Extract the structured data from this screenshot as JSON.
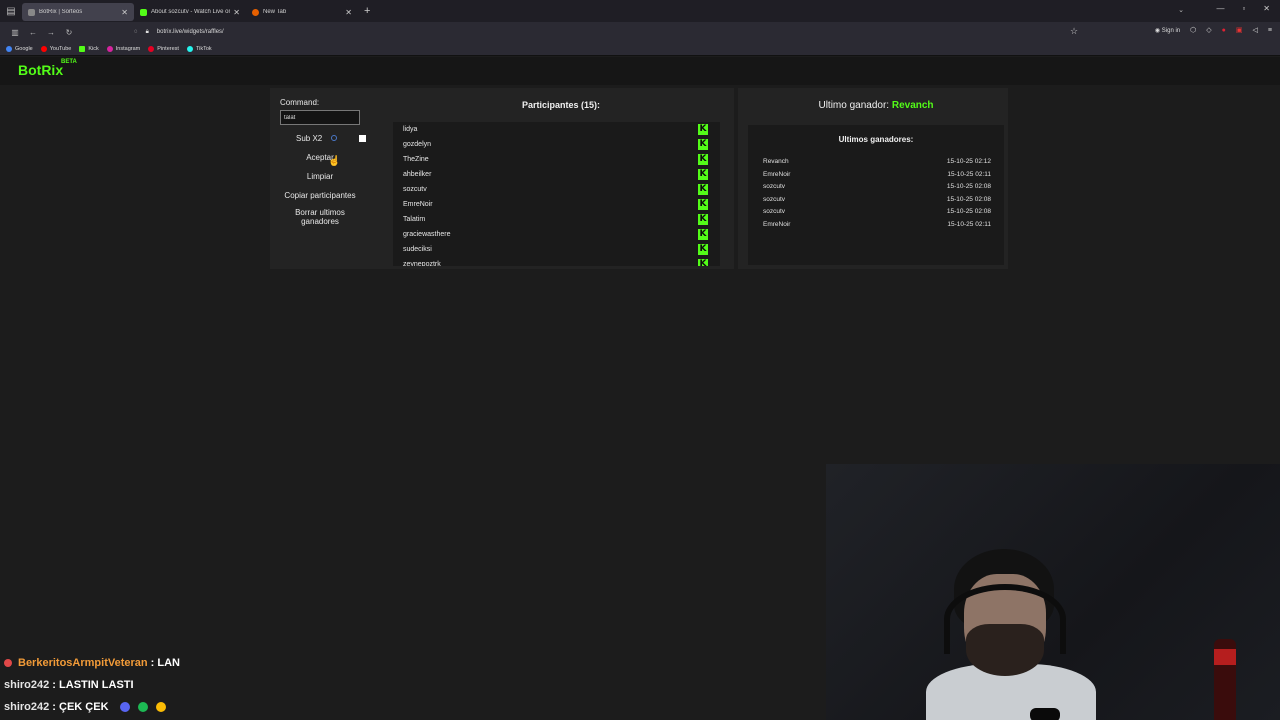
{
  "browser": {
    "tabs": [
      {
        "label": "BotRix | Sorteos",
        "active": true
      },
      {
        "label": "About sozcutv - Watch Live on",
        "active": false
      },
      {
        "label": "New Tab",
        "active": false
      }
    ],
    "url": "botrix.live/widgets/raffles/",
    "signin_label": "Sign in",
    "bookmarks": [
      "Google",
      "YouTube",
      "Kick",
      "Instagram",
      "Pinterest",
      "TikTok"
    ]
  },
  "app": {
    "logo": "BotRix",
    "beta": "BETA"
  },
  "controls": {
    "command_label": "Command:",
    "command_value": "talat",
    "sub_label": "Sub X2",
    "accept_label": "Aceptar",
    "clear_label": "Limpiar",
    "copy_label": "Copiar participantes",
    "delete_label_1": "Borrar ultimos",
    "delete_label_2": "ganadores"
  },
  "participants": {
    "title": "Participantes (15):",
    "badge": "K",
    "items": [
      "lidya",
      "gozdelyn",
      "TheZine",
      "ahbeilker",
      "sozcutv",
      "EmreNoir",
      "Talatim",
      "graciewasthere",
      "sudeciksi",
      "zeynepoztrk"
    ]
  },
  "winners": {
    "last_winner_label": "Ultimo ganador:",
    "last_winner_name": "Revanch",
    "title": "Ultimos ganadores:",
    "rows": [
      {
        "name": "Revanch",
        "date": "15-10-25 02:12"
      },
      {
        "name": "EmreNoir",
        "date": "15-10-25 02:11"
      },
      {
        "name": "sozcutv",
        "date": "15-10-25 02:08"
      },
      {
        "name": "sozcutv",
        "date": "15-10-25 02:08"
      },
      {
        "name": "sozcutv",
        "date": "15-10-25 02:08"
      },
      {
        "name": "EmreNoir",
        "date": "15-10-25 02:11"
      }
    ]
  },
  "chat": [
    {
      "user": "BerkeritosArmpitVeteran",
      "message": "LAN"
    },
    {
      "user": "shiro242",
      "message": "LASTIN LASTI"
    },
    {
      "user": "shiro242",
      "message": "ÇEK ÇEK"
    }
  ],
  "colors": {
    "accent": "#53fc18",
    "background": "#1c1c1c",
    "panel": "#232323"
  }
}
